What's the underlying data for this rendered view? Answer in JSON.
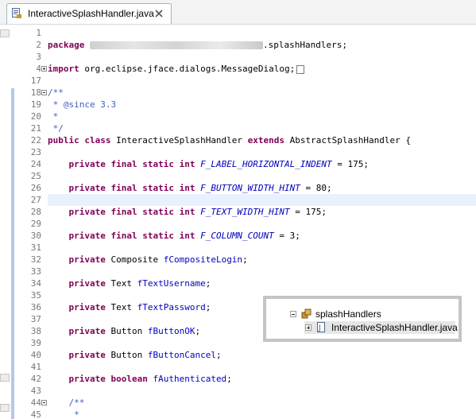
{
  "tab": {
    "title": "InteractiveSplashHandler.java",
    "icons": {
      "file": "java-file-icon",
      "close": "close-icon"
    }
  },
  "editor": {
    "lines": [
      {
        "n": "1",
        "fold": "",
        "segments": []
      },
      {
        "n": "2",
        "fold": "",
        "segments": [
          {
            "t": "package",
            "c": "kw"
          },
          {
            "t": " "
          },
          {
            "t": "",
            "c": "blur"
          },
          {
            "t": ".splashHandlers;"
          }
        ]
      },
      {
        "n": "3",
        "fold": "",
        "segments": []
      },
      {
        "n": "4",
        "fold": "plus",
        "segments": [
          {
            "t": "import",
            "c": "kw"
          },
          {
            "t": " org.eclipse.jface.dialogs.MessageDialog;"
          },
          {
            "t": "",
            "c": "collapsed-box"
          }
        ]
      },
      {
        "n": "17",
        "fold": "",
        "segments": []
      },
      {
        "n": "18",
        "fold": "minus",
        "segments": [
          {
            "t": "/**",
            "c": "cmt"
          }
        ]
      },
      {
        "n": "19",
        "fold": "",
        "segments": [
          {
            "t": " * @since 3.3",
            "c": "cmt"
          }
        ]
      },
      {
        "n": "20",
        "fold": "",
        "segments": [
          {
            "t": " *",
            "c": "cmt"
          }
        ]
      },
      {
        "n": "21",
        "fold": "",
        "segments": [
          {
            "t": " */",
            "c": "cmt"
          }
        ]
      },
      {
        "n": "22",
        "fold": "",
        "segments": [
          {
            "t": "public class",
            "c": "kw"
          },
          {
            "t": " InteractiveSplashHandler "
          },
          {
            "t": "extends",
            "c": "kw"
          },
          {
            "t": " AbstractSplashHandler {"
          }
        ]
      },
      {
        "n": "23",
        "fold": "",
        "segments": []
      },
      {
        "n": "24",
        "fold": "",
        "segments": [
          {
            "t": "    "
          },
          {
            "t": "private final static int",
            "c": "kw"
          },
          {
            "t": " "
          },
          {
            "t": "F_LABEL_HORIZONTAL_INDENT",
            "c": "fld"
          },
          {
            "t": " = 175;"
          }
        ]
      },
      {
        "n": "25",
        "fold": "",
        "segments": []
      },
      {
        "n": "26",
        "fold": "",
        "segments": [
          {
            "t": "    "
          },
          {
            "t": "private final static int",
            "c": "kw"
          },
          {
            "t": " "
          },
          {
            "t": "F_BUTTON_WIDTH_HINT",
            "c": "fld"
          },
          {
            "t": " = 80;"
          }
        ]
      },
      {
        "n": "27",
        "fold": "",
        "current": true,
        "segments": []
      },
      {
        "n": "28",
        "fold": "",
        "segments": [
          {
            "t": "    "
          },
          {
            "t": "private final static int",
            "c": "kw"
          },
          {
            "t": " "
          },
          {
            "t": "F_TEXT_WIDTH_HINT",
            "c": "fld"
          },
          {
            "t": " = 175;"
          }
        ]
      },
      {
        "n": "29",
        "fold": "",
        "segments": []
      },
      {
        "n": "30",
        "fold": "",
        "segments": [
          {
            "t": "    "
          },
          {
            "t": "private final static int",
            "c": "kw"
          },
          {
            "t": " "
          },
          {
            "t": "F_COLUMN_COUNT",
            "c": "fld"
          },
          {
            "t": " = 3;"
          }
        ]
      },
      {
        "n": "31",
        "fold": "",
        "segments": []
      },
      {
        "n": "32",
        "fold": "",
        "segments": [
          {
            "t": "    "
          },
          {
            "t": "private",
            "c": "kw"
          },
          {
            "t": " Composite "
          },
          {
            "t": "fCompositeLogin",
            "c": "fld2"
          },
          {
            "t": ";"
          }
        ]
      },
      {
        "n": "33",
        "fold": "",
        "segments": []
      },
      {
        "n": "34",
        "fold": "",
        "segments": [
          {
            "t": "    "
          },
          {
            "t": "private",
            "c": "kw"
          },
          {
            "t": " Text "
          },
          {
            "t": "fTextUsername",
            "c": "fld2"
          },
          {
            "t": ";"
          }
        ]
      },
      {
        "n": "35",
        "fold": "",
        "segments": []
      },
      {
        "n": "36",
        "fold": "",
        "segments": [
          {
            "t": "    "
          },
          {
            "t": "private",
            "c": "kw"
          },
          {
            "t": " Text "
          },
          {
            "t": "fTextPassword",
            "c": "fld2"
          },
          {
            "t": ";"
          }
        ]
      },
      {
        "n": "37",
        "fold": "",
        "segments": []
      },
      {
        "n": "38",
        "fold": "",
        "segments": [
          {
            "t": "    "
          },
          {
            "t": "private",
            "c": "kw"
          },
          {
            "t": " Button "
          },
          {
            "t": "fButtonOK",
            "c": "fld2"
          },
          {
            "t": ";"
          }
        ]
      },
      {
        "n": "39",
        "fold": "",
        "segments": []
      },
      {
        "n": "40",
        "fold": "",
        "segments": [
          {
            "t": "    "
          },
          {
            "t": "private",
            "c": "kw"
          },
          {
            "t": " Button "
          },
          {
            "t": "fButtonCancel",
            "c": "fld2"
          },
          {
            "t": ";"
          }
        ]
      },
      {
        "n": "41",
        "fold": "",
        "segments": []
      },
      {
        "n": "42",
        "fold": "",
        "segments": [
          {
            "t": "    "
          },
          {
            "t": "private boolean",
            "c": "kw"
          },
          {
            "t": " "
          },
          {
            "t": "fAuthenticated",
            "c": "fld2"
          },
          {
            "t": ";"
          }
        ]
      },
      {
        "n": "43",
        "fold": "",
        "segments": []
      },
      {
        "n": "44",
        "fold": "minus",
        "segments": [
          {
            "t": "    "
          },
          {
            "t": "/**",
            "c": "cmt"
          }
        ]
      },
      {
        "n": "45",
        "fold": "",
        "segments": [
          {
            "t": "     *",
            "c": "cmt"
          }
        ]
      }
    ],
    "colors": {
      "keyword": "#7f0055",
      "field": "#0000c0",
      "comment": "#3f5fbf",
      "current_line": "#e8f2fe"
    }
  },
  "package_popup": {
    "items": [
      {
        "label": "splashHandlers",
        "icon": "package-icon",
        "toggle": "minus"
      },
      {
        "label": "InteractiveSplashHandler.java",
        "icon": "java-file-icon",
        "toggle": "plus",
        "selected": true
      }
    ]
  }
}
